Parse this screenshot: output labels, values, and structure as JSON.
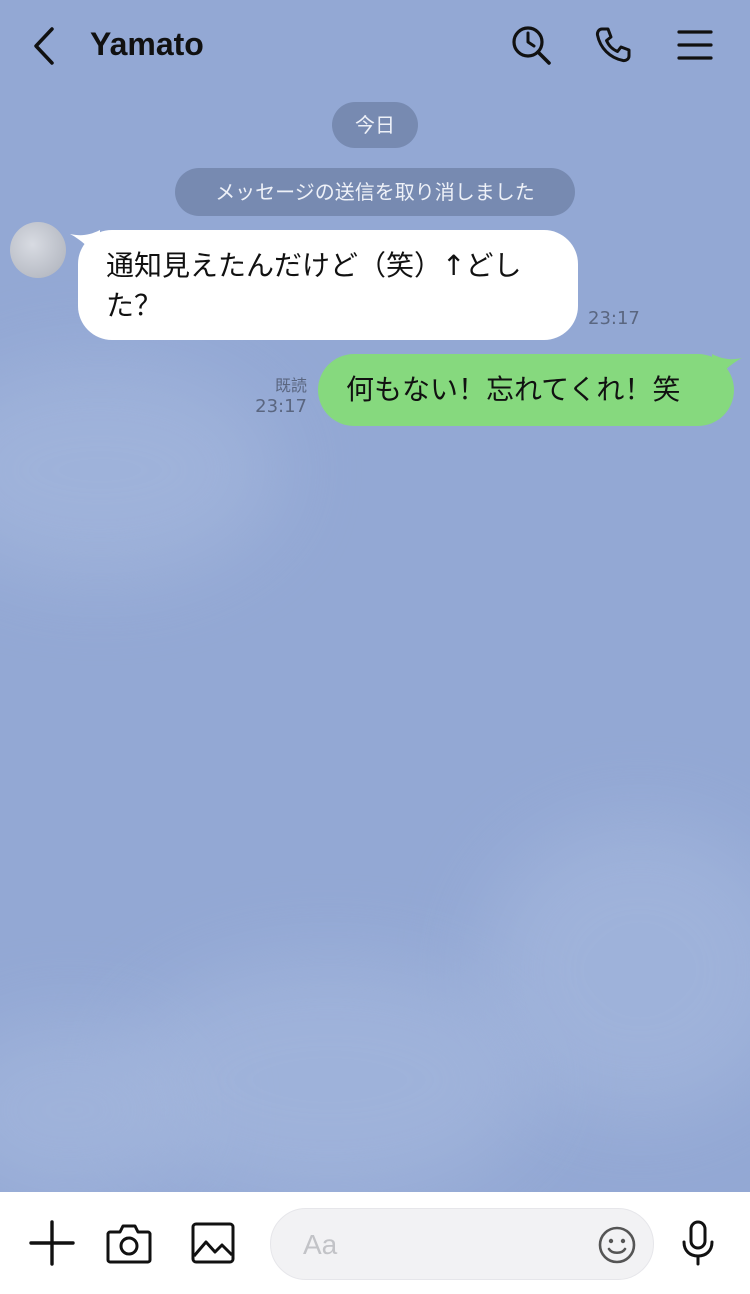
{
  "header": {
    "title": "Yamato",
    "back_icon": "chevron-left-icon",
    "search_icon": "search-clock-icon",
    "call_icon": "phone-icon",
    "menu_icon": "hamburger-menu-icon"
  },
  "chat": {
    "date_label": "今日",
    "system_message": "メッセージの送信を取り消しました",
    "messages": [
      {
        "direction": "incoming",
        "text_line1": "通知見えたんだけど（笑）↑どし",
        "text_line2": "た？",
        "time": "23:17"
      },
      {
        "direction": "outgoing",
        "text": "何もない！忘れてくれ！笑",
        "read_status": "既読",
        "time": "23:17"
      }
    ]
  },
  "toolbar": {
    "plus_icon": "plus-icon",
    "camera_icon": "camera-icon",
    "image_icon": "image-icon",
    "input_placeholder": "Aa",
    "input_value": "",
    "emoji_icon": "smiley-icon",
    "mic_icon": "microphone-icon"
  },
  "colors": {
    "background": "#93a8d4",
    "outgoing_bubble": "#86d97e",
    "incoming_bubble": "#ffffff",
    "pill": "#6e80a5"
  }
}
